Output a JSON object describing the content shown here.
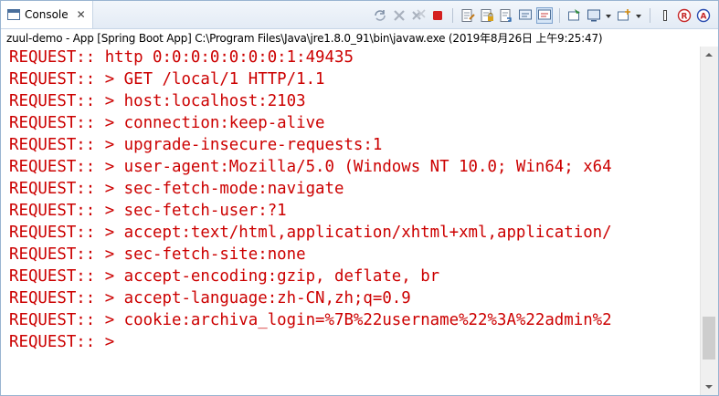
{
  "tab": {
    "label": "Console",
    "close": "✕"
  },
  "toolbar": {
    "icons": [
      "terminate-relaunch-icon",
      "remove-launch-icon",
      "remove-all-terminated-icon",
      "terminate-icon",
      "clear-console-icon",
      "scroll-lock-icon",
      "word-wrap-icon",
      "show-on-output-icon",
      "show-on-error-icon",
      "pin-console-icon",
      "display-selected-console-icon",
      "open-console-icon",
      "view-menu-icon",
      "minimize-icon",
      "maximize-icon"
    ]
  },
  "description": "zuul-demo - App [Spring Boot App] C:\\Program Files\\Java\\jre1.8.0_91\\bin\\javaw.exe (2019年8月26日 上午9:25:47)",
  "console": {
    "lines": [
      "REQUEST:: http 0:0:0:0:0:0:0:1:49435",
      "REQUEST:: > GET /local/1 HTTP/1.1",
      "REQUEST:: > host:localhost:2103",
      "REQUEST:: > connection:keep-alive",
      "REQUEST:: > upgrade-insecure-requests:1",
      "REQUEST:: > user-agent:Mozilla/5.0 (Windows NT 10.0; Win64; x64",
      "REQUEST:: > sec-fetch-mode:navigate",
      "REQUEST:: > sec-fetch-user:?1",
      "REQUEST:: > accept:text/html,application/xhtml+xml,application/",
      "REQUEST:: > sec-fetch-site:none",
      "REQUEST:: > accept-encoding:gzip, deflate, br",
      "REQUEST:: > accept-language:zh-CN,zh;q=0.9",
      "REQUEST:: > cookie:archiva_login=%7B%22username%22%3A%22admin%2",
      "REQUEST:: >"
    ]
  },
  "colors": {
    "output": "#cc0000",
    "tab_border": "#99b4d1"
  }
}
